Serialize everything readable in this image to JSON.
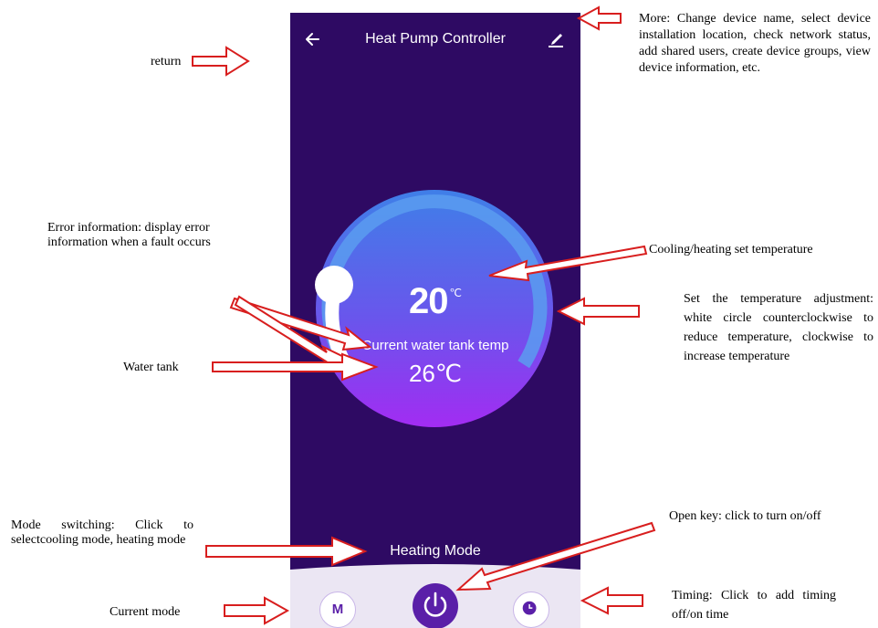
{
  "app": {
    "title": "Heat Pump Controller",
    "back_icon": "back-arrow-icon",
    "edit_icon": "edit-pencil-icon"
  },
  "dial": {
    "set_temperature": "20",
    "set_temperature_unit": "℃",
    "tank_label": "Current water tank temp",
    "tank_temperature": "26℃",
    "knob_icon": "white-circle-knob"
  },
  "mode": {
    "label": "Heating Mode"
  },
  "bottom_bar": {
    "mode_button_label": "M",
    "power_icon": "power-icon",
    "timer_icon": "clock-icon"
  },
  "annotations": {
    "return": "return",
    "more": "More: Change device name, select device installation location, check network status, add shared users, create device groups, view device information, etc.",
    "error_info": "Error information: display error information when a fault occurs",
    "set_temp": "Cooling/heating set temperature",
    "adjust": "Set the temperature adjustment: white circle counterclockwise to reduce temperature, clockwise to increase temperature",
    "water_tank": "Water tank",
    "mode_switching": "Mode switching: Click to selectcooling mode, heating mode",
    "open_key": "Open key: click to turn on/off",
    "current_mode": "Current mode",
    "timing": "Timing: Click to add timing off/on time"
  },
  "colors": {
    "background": "#2e0a63",
    "dial_blue": "#4a78e6",
    "dial_purple": "#9b30f0",
    "ring": "#5b9cf0",
    "accent": "#5a1fa8",
    "arrow": "#d81e1e"
  }
}
